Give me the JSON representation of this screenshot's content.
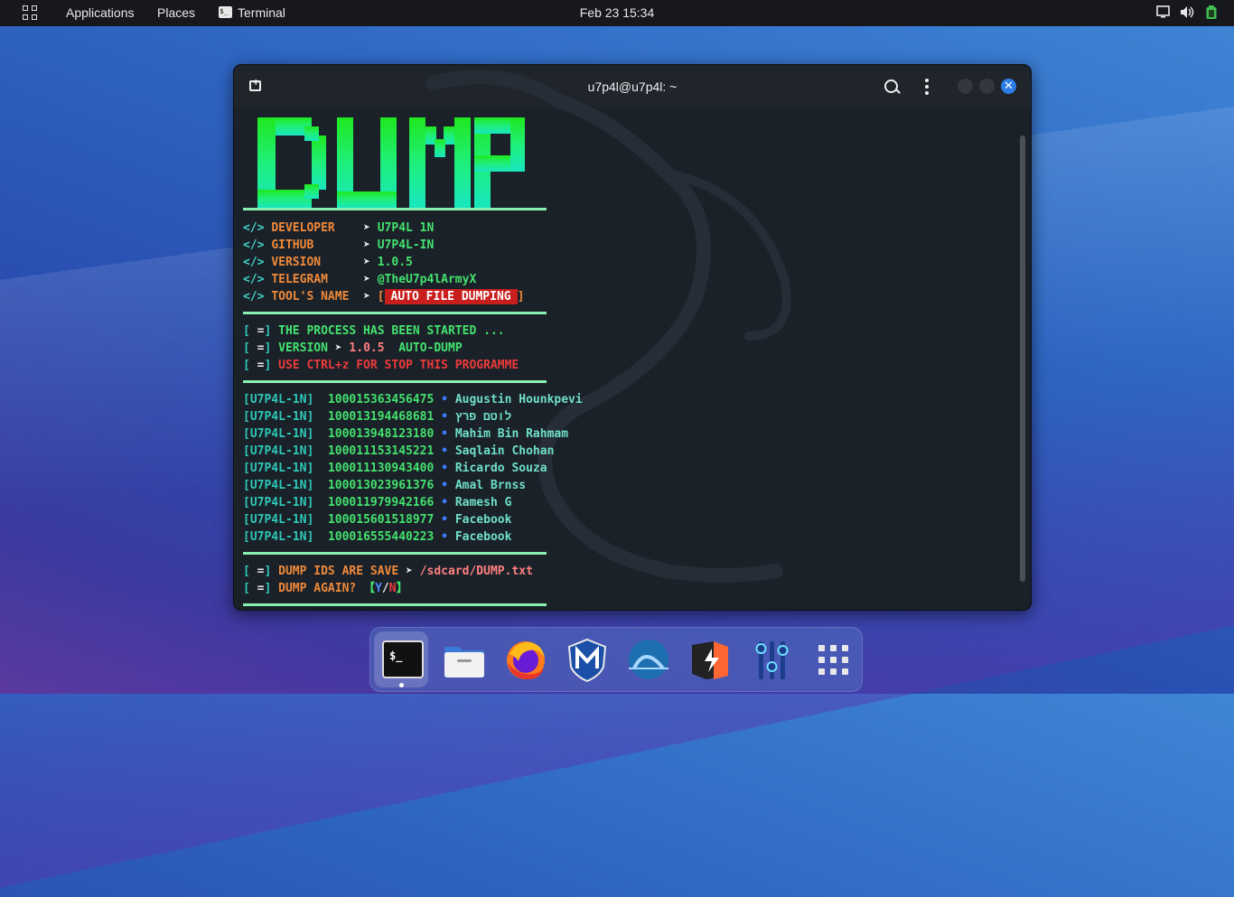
{
  "topbar": {
    "applications": "Applications",
    "places": "Places",
    "terminal": "Terminal",
    "clock": "Feb 23  15:34",
    "icons": [
      "apps-grid-icon",
      "screen-icon",
      "volume-icon",
      "battery-icon"
    ]
  },
  "window": {
    "title": "u7p4l@u7p4l: ~",
    "buttons": [
      "new-tab-icon",
      "search-icon",
      "menu-icon",
      "minimize",
      "maximize",
      "close"
    ]
  },
  "terminal": {
    "logo": "DUMP",
    "info": [
      {
        "tag": "</>",
        "key": "DEVELOPER    ",
        "arrow": "➤",
        "value": "U7P4L 1N"
      },
      {
        "tag": "</>",
        "key": "GITHUB       ",
        "arrow": "➤",
        "value": "U7P4L-IN"
      },
      {
        "tag": "</>",
        "key": "VERSION      ",
        "arrow": "➤",
        "value": "1.0.5"
      },
      {
        "tag": "</>",
        "key": "TELEGRAM     ",
        "arrow": "➤",
        "value": "@TheU7p4lArmyX"
      },
      {
        "tag": "</>",
        "key": "TOOL'S NAME  ",
        "arrow": "➤",
        "value": "AUTO FILE DUMPING"
      }
    ],
    "status": [
      {
        "open": "[",
        "mark": "=",
        "close": "]",
        "text": "THE PROCESS HAS BEEN STARTED ..."
      },
      {
        "open": "[",
        "mark": "=",
        "close": "]",
        "text": "VERSION",
        "arrow": "➤",
        "version": "1.0.5",
        "extra": "AUTO-DUMP"
      },
      {
        "open": "[",
        "mark": "=",
        "close": "]",
        "text": "USE CTRL+z FOR STOP THIS PROGRAMME"
      }
    ],
    "results": [
      {
        "tag": "U7P4L-1N",
        "id": "100015363456475",
        "bullet": "•",
        "name": "Augustin Hounkpevi"
      },
      {
        "tag": "U7P4L-1N",
        "id": "100013194468681",
        "bullet": "•",
        "name": "לוטם פרץ"
      },
      {
        "tag": "U7P4L-1N",
        "id": "100013948123180",
        "bullet": "•",
        "name": "Mahim Bin Rahmam"
      },
      {
        "tag": "U7P4L-1N",
        "id": "100011153145221",
        "bullet": "•",
        "name": "Saqlain Chohan"
      },
      {
        "tag": "U7P4L-1N",
        "id": "100011130943400",
        "bullet": "•",
        "name": "Ricardo Souza"
      },
      {
        "tag": "U7P4L-1N",
        "id": "100013023961376",
        "bullet": "•",
        "name": "Amal Brnss"
      },
      {
        "tag": "U7P4L-1N",
        "id": "100011979942166",
        "bullet": "•",
        "name": "Ramesh G"
      },
      {
        "tag": "U7P4L-1N",
        "id": "100015601518977",
        "bullet": "•",
        "name": "Facebook"
      },
      {
        "tag": "U7P4L-1N",
        "id": "100016555440223",
        "bullet": "•",
        "name": "Facebook"
      }
    ],
    "footer": {
      "saved_label": "DUMP IDS ARE SAVE",
      "arrow": "➤",
      "saved_path": "/sdcard/DUMP.txt",
      "again_label": "DUMP AGAIN?",
      "bracket_open": "【",
      "yes": "Y",
      "slash": "/",
      "no": "N",
      "bracket_close": "】",
      "mark": "="
    }
  },
  "dock": {
    "items": [
      "terminal-app",
      "files-app",
      "firefox-app",
      "metasploit-app",
      "wireshark-app",
      "burpsuite-app",
      "settings-mixer-app",
      "show-apps"
    ]
  },
  "colors": {
    "terminal_bg": "#1b2129",
    "accent_green": "#00ff7f",
    "accent_blue": "#2d7de8"
  }
}
